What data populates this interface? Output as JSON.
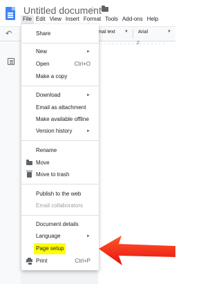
{
  "header": {
    "doc_title": "Untitled document",
    "star_icon": "star-icon",
    "folder_icon": "folder-icon"
  },
  "menubar": {
    "items": [
      "File",
      "Edit",
      "View",
      "Insert",
      "Format",
      "Tools",
      "Add-ons",
      "Help"
    ]
  },
  "toolbar": {
    "style_value": "ormal text",
    "font_value": "Arial"
  },
  "ruler": {
    "marker": "2"
  },
  "file_menu": {
    "items": [
      {
        "label": "Share"
      },
      {
        "label": "New"
      },
      {
        "label": "Open",
        "shortcut": "Ctrl+O"
      },
      {
        "label": "Make a copy"
      },
      {
        "label": "Download"
      },
      {
        "label": "Email as attachment"
      },
      {
        "label": "Make available offline"
      },
      {
        "label": "Version history"
      },
      {
        "label": "Rename"
      },
      {
        "label": "Move"
      },
      {
        "label": "Move to trash"
      },
      {
        "label": "Publish to the web"
      },
      {
        "label": "Email collaborators"
      },
      {
        "label": "Document details"
      },
      {
        "label": "Language"
      },
      {
        "label": "Page setup"
      },
      {
        "label": "Print",
        "shortcut": "Ctrl+P"
      }
    ]
  },
  "colors": {
    "highlight": "#ffff00",
    "annotation_arrow": "#ff2a12",
    "doc_blue": "#4285f4"
  }
}
